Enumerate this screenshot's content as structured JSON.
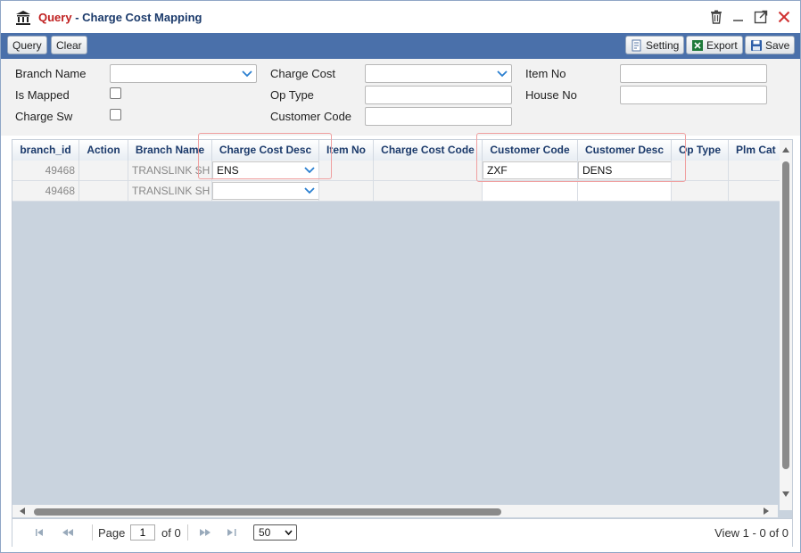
{
  "window": {
    "title_prefix": "Query",
    "title_separator": " - ",
    "title": "Charge Cost Mapping"
  },
  "icons": {
    "title": "bank-icon",
    "delete": "trash-icon",
    "minimize": "minimize-icon",
    "maximize": "maximize-icon",
    "close": "close-icon",
    "setting": "setting-icon",
    "export": "excel-icon",
    "save": "save-icon"
  },
  "colors": {
    "toolbar": "#4a70aa",
    "title_accent": "#c02020",
    "title_text": "#1b3a6b",
    "highlight": "#f0a0a0",
    "close": "#d03030"
  },
  "toolbar": {
    "query_label": "Query",
    "clear_label": "Clear",
    "setting_label": "Setting",
    "export_label": "Export",
    "save_label": "Save"
  },
  "filters": {
    "branch_name_label": "Branch Name",
    "is_mapped_label": "Is Mapped",
    "charge_sw_label": "Charge Sw",
    "charge_cost_label": "Charge Cost",
    "op_type_label": "Op Type",
    "customer_code_label": "Customer Code",
    "item_no_label": "Item No",
    "house_no_label": "House No"
  },
  "grid": {
    "columns": [
      "branch_id",
      "Action",
      "Branch Name",
      "Charge Cost Desc",
      "Item No",
      "Charge Cost Code",
      "Customer Code",
      "Customer Desc",
      "Op Type",
      "Plm Cat"
    ],
    "rows": [
      {
        "branch_id": "49468",
        "action": "",
        "branch_name": "TRANSLINK SH",
        "charge_cost_desc": "ENS",
        "item_no": "",
        "charge_cost_code": "",
        "customer_code": "ZXF",
        "customer_desc": "DENS",
        "op_type": "",
        "plm_cat": ""
      },
      {
        "branch_id": "49468",
        "action": "",
        "branch_name": "TRANSLINK SH",
        "charge_cost_desc": "",
        "item_no": "",
        "charge_cost_code": "",
        "customer_code": "",
        "customer_desc": "",
        "op_type": "",
        "plm_cat": ""
      }
    ]
  },
  "pager": {
    "page_label": "Page",
    "page_value": "1",
    "of_label": "of 0",
    "page_size": "50",
    "page_size_options": [
      "50"
    ],
    "view_text": "View 1 - 0 of 0"
  }
}
